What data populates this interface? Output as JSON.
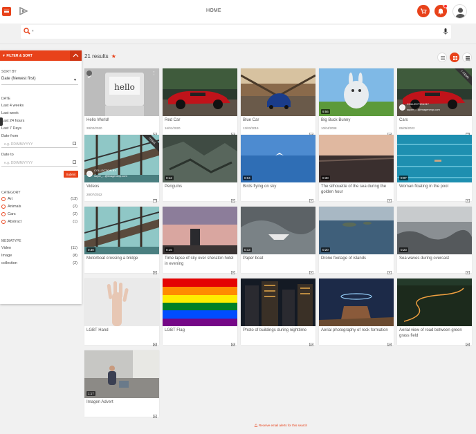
{
  "header": {
    "title": "HOME",
    "accent": "#e8421a"
  },
  "search": {
    "value": "*",
    "placeholder": ""
  },
  "filters": {
    "heading": "FILTER & SORT",
    "sort_by_label": "SORT BY",
    "sort_by_value": "Date (Newest first)",
    "date_label": "DATE",
    "date_options": [
      "Last 4 weeks",
      "Last week",
      "Last 24 hours",
      "Last 7 Days"
    ],
    "date_from_label": "Date from",
    "date_to_label": "Date to",
    "date_placeholder": "e.g. DD/MM/YYYY",
    "submit_label": "Submit",
    "category_label": "CATEGORY",
    "categories": [
      {
        "name": "Art",
        "count": "(13)"
      },
      {
        "name": "Animals",
        "count": "(2)"
      },
      {
        "name": "Cars",
        "count": "(2)"
      },
      {
        "name": "Abstract",
        "count": "(1)"
      }
    ],
    "mediatype_label": "MEDIATYPE",
    "mediatypes": [
      {
        "name": "Video",
        "count": "(11)"
      },
      {
        "name": "Image",
        "count": "(8)"
      },
      {
        "name": "collection",
        "count": "(2)"
      }
    ]
  },
  "results": {
    "count_text": "21 results",
    "star": "★"
  },
  "cards": [
    {
      "title": "Hello World!",
      "date": "28/02/2020",
      "type": "image",
      "badge": "check",
      "thumb": "hello"
    },
    {
      "title": "Red Car",
      "date": "16/01/2020",
      "type": "image",
      "thumb": "redcar"
    },
    {
      "title": "Blue Car",
      "date": "13/03/2019",
      "type": "image",
      "thumb": "bluecar"
    },
    {
      "title": "Big Buck Bunny",
      "date": "10/04/2008",
      "type": "image",
      "duration": "9:56",
      "thumb": "bunny"
    },
    {
      "title": "Cars",
      "date": "06/05/2022",
      "type": "collection",
      "collection_by": "COLLECTION BY",
      "collection_user": "super_...@imagenevp.com",
      "banner": "7 ITEMS",
      "thumb": "redcar"
    },
    {
      "title": "Videos",
      "date": "28/07/2022",
      "type": "collection",
      "collection_by": "COLLECTION BY",
      "collection_user": "super_...@imagenevp.com",
      "banner": "ITEMS",
      "thumb": "bridge"
    },
    {
      "title": "Penguins",
      "date": "",
      "type": "video",
      "duration": "0:12",
      "thumb": "rock"
    },
    {
      "title": "Birds flying on sky",
      "date": "",
      "type": "video",
      "duration": "0:04",
      "thumb": "sky"
    },
    {
      "title": "The silhouette of the sea during the golden hour",
      "date": "",
      "type": "video",
      "duration": "0:30",
      "thumb": "sunset"
    },
    {
      "title": "Woman floating in the pool",
      "date": "",
      "type": "video",
      "duration": "0:07",
      "thumb": "pool"
    },
    {
      "title": "Motorboat crossing a bridge",
      "date": "",
      "type": "video",
      "duration": "0:30",
      "thumb": "bridge"
    },
    {
      "title": "Time lapse of sky over sheraton hotel in evening",
      "date": "",
      "type": "video",
      "duration": "0:15",
      "thumb": "dusk"
    },
    {
      "title": "Paper boat",
      "date": "",
      "type": "video",
      "duration": "0:13",
      "thumb": "paper"
    },
    {
      "title": "Drone footage of islands",
      "date": "",
      "type": "video",
      "duration": "0:20",
      "thumb": "islands"
    },
    {
      "title": "Sea waves during overcast",
      "date": "",
      "type": "video",
      "duration": "0:23",
      "thumb": "waves"
    },
    {
      "title": "LGBT Hand",
      "date": "",
      "type": "image",
      "thumb": "hand"
    },
    {
      "title": "LGBT Flag",
      "date": "",
      "type": "image",
      "thumb": "flag"
    },
    {
      "title": "Photo of buildings during nighttime",
      "date": "",
      "type": "image",
      "thumb": "city"
    },
    {
      "title": "Aerial photography of rock formation",
      "date": "",
      "type": "image",
      "thumb": "rockform"
    },
    {
      "title": "Aerial view of road between green grass field",
      "date": "",
      "type": "image",
      "thumb": "road"
    },
    {
      "title": "Imagen Advert",
      "date": "",
      "type": "video",
      "duration": "1:17",
      "thumb": "advert"
    }
  ],
  "footer": {
    "email_alert": "Receive email alerts for this search"
  }
}
